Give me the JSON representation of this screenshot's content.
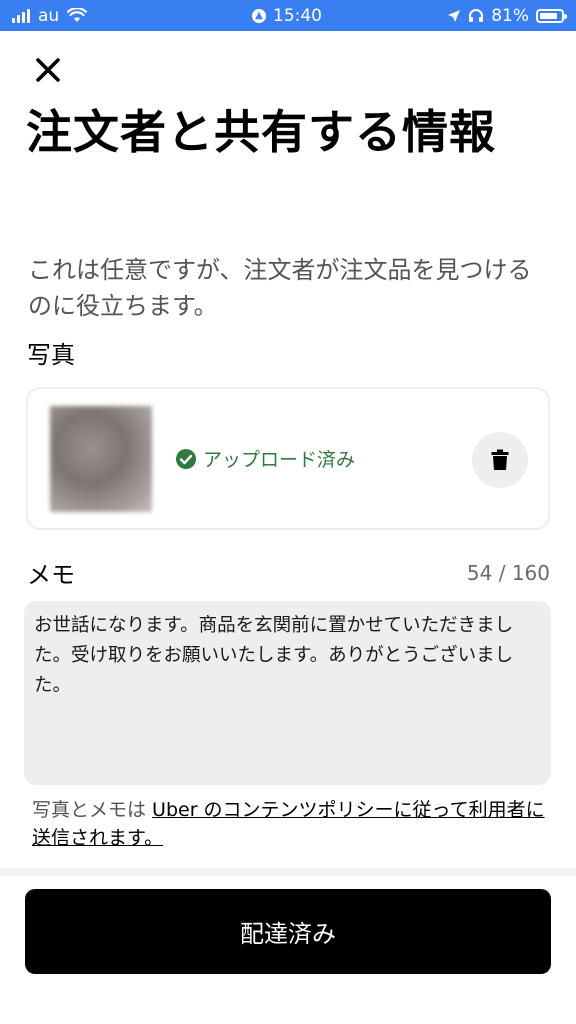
{
  "status_bar": {
    "carrier": "au",
    "time": "15:40",
    "battery": "81%",
    "signal_bars": 4
  },
  "header": {
    "title": "注文者と共有する情報",
    "subtitle": "これは任意ですが、注文者が注文品を見つけるのに役立ちます。"
  },
  "photo": {
    "label": "写真",
    "status": "アップロード済み"
  },
  "memo": {
    "label": "メモ",
    "count": "54 / 160",
    "text": "お世話になります。商品を玄関前に置かせていただきました。受け取りをお願いいたします。ありがとうございました。"
  },
  "policy": {
    "prefix": "写真とメモは ",
    "link": "Uber のコンテンツポリシーに従って利用者に送信されます。"
  },
  "actions": {
    "primary": "配達済み"
  },
  "colors": {
    "status_bar": "#3a7ff1",
    "success": "#2f7a3f",
    "primary_button": "#000000"
  }
}
